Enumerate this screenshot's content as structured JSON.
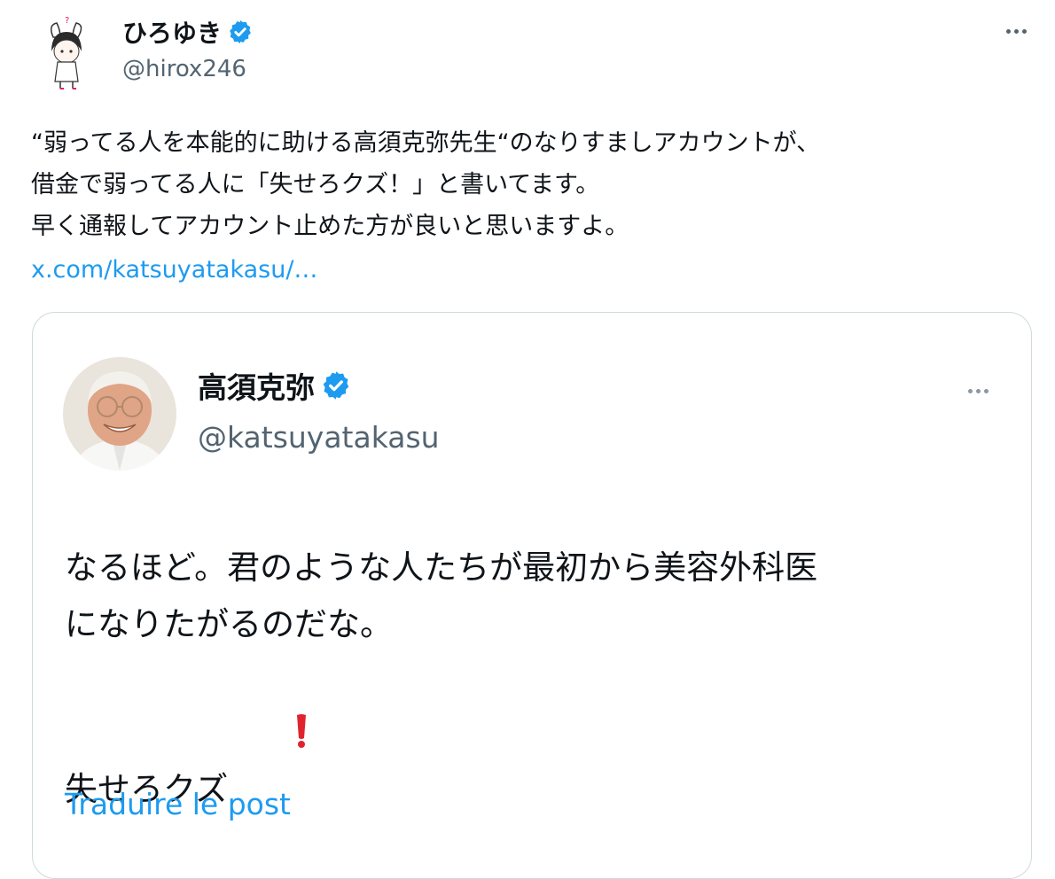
{
  "post": {
    "author": {
      "display_name": "ひろゆき",
      "handle": "@hirox246",
      "verified": true,
      "avatar_icon": "cartoon-avatar-icon"
    },
    "text": "“弱ってる人を本能的に助ける高須克弥先生“のなりすましアカウントが、\n借金で弱ってる人に「失せろクズ！」と書いてます。\n早く通報してアカウント止めた方が良いと思いますよ。",
    "link": "x.com/katsuyatakasu/…"
  },
  "quote": {
    "author": {
      "display_name": "高須克弥",
      "handle": "@katsuyatakasu",
      "verified": true,
      "avatar_icon": "profile-photo-icon"
    },
    "text": "なるほど。君のような人たちが最初から美容外科医\nになりたがるのだな。\n失せろクズ",
    "emoji": "red-exclamation-icon",
    "translate_label": "Traduire le post"
  },
  "colors": {
    "text_primary": "#0f1419",
    "text_secondary": "#536471",
    "accent": "#1d9bf0",
    "border": "#cfd9de",
    "verified_badge": "#1d9bf0"
  }
}
